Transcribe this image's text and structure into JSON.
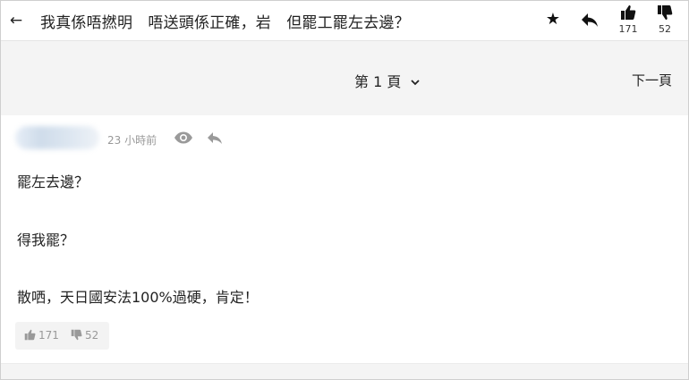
{
  "topbar": {
    "title": "我真係唔撚明　唔送頭係正確，岩　但罷工罷左去邊？",
    "upvotes": "171",
    "downvotes": "52"
  },
  "pagination": {
    "current_page_label": "第 1 頁",
    "next_page_label": "下一頁"
  },
  "post": {
    "timestamp": "23 小時前",
    "lines": [
      "罷左去邊？",
      "得我罷？",
      "散哂，天日國安法100%過硬，肯定！"
    ],
    "upvotes": "171",
    "downvotes": "52"
  },
  "icons": {
    "back": "arrow-left-icon",
    "favorite": "star-icon",
    "reply": "reply-arrow-icon",
    "upvote": "thumb-up-icon",
    "downvote": "thumb-down-icon",
    "view": "eye-icon",
    "dropdown": "chevron-down-icon"
  }
}
